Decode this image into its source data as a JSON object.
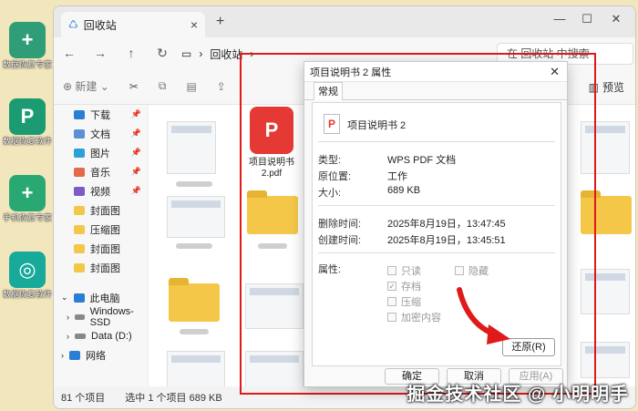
{
  "desktop": {
    "icons": [
      {
        "label": "数据恢复专家",
        "color": "#2f9d78",
        "glyph": "+"
      },
      {
        "label": "数据恢复软件",
        "color": "#1c9b72",
        "glyph": "P"
      },
      {
        "label": "手机恢复专家",
        "color": "#2aa874",
        "glyph": "+"
      },
      {
        "label": "数据恢复软件",
        "color": "#17a99a",
        "glyph": "◎"
      }
    ]
  },
  "explorer": {
    "tab_title": "回收站",
    "breadcrumb": "回收站",
    "search_placeholder": "在 回收站 中搜索",
    "toolbar": {
      "new_label": "新建",
      "preview_label": "预览"
    },
    "sidebar": {
      "quick": [
        {
          "label": "下载",
          "icon": "download-icon",
          "color": "#2a7fd4"
        },
        {
          "label": "文档",
          "icon": "document-icon",
          "color": "#5b8fd6"
        },
        {
          "label": "图片",
          "icon": "picture-icon",
          "color": "#2ca0d8"
        },
        {
          "label": "音乐",
          "icon": "music-icon",
          "color": "#e06a4a"
        },
        {
          "label": "视频",
          "icon": "video-icon",
          "color": "#7a5cc8"
        },
        {
          "label": "封面图",
          "icon": "folder-icon",
          "color": "#f5c748"
        },
        {
          "label": "压缩图",
          "icon": "folder-icon",
          "color": "#f5c748"
        },
        {
          "label": "封面图",
          "icon": "folder-icon",
          "color": "#f5c748"
        },
        {
          "label": "封面图",
          "icon": "folder-icon",
          "color": "#f5c748"
        }
      ],
      "this_pc": "此电脑",
      "drives": [
        "Windows-SSD",
        "Data (D:)"
      ],
      "network": "网络"
    },
    "file_name": "项目说明书 2.pdf",
    "status": {
      "count": "81 个项目",
      "selected": "选中 1 个项目  689 KB"
    }
  },
  "dialog": {
    "title": "项目说明书 2 属性",
    "tab": "常规",
    "file_name": "项目说明书 2",
    "props": {
      "type_k": "类型:",
      "type_v": "WPS PDF 文档",
      "loc_k": "原位置:",
      "loc_v": "工作",
      "size_k": "大小:",
      "size_v": "689 KB",
      "del_k": "删除时间:",
      "del_v": "2025年8月19日，13:47:45",
      "create_k": "创建时间:",
      "create_v": "2025年8月19日，13:45:51",
      "attr_k": "属性:"
    },
    "attrs": {
      "readonly": "只读",
      "hidden": "隐藏",
      "archive": "存档",
      "compress": "压缩",
      "encrypt": "加密内容"
    },
    "restore_label": "还原(R)",
    "ok_label": "确定",
    "cancel_label": "取消",
    "apply_label": "应用(A)"
  },
  "watermark": "掘金技术社区 @ 小明明手"
}
